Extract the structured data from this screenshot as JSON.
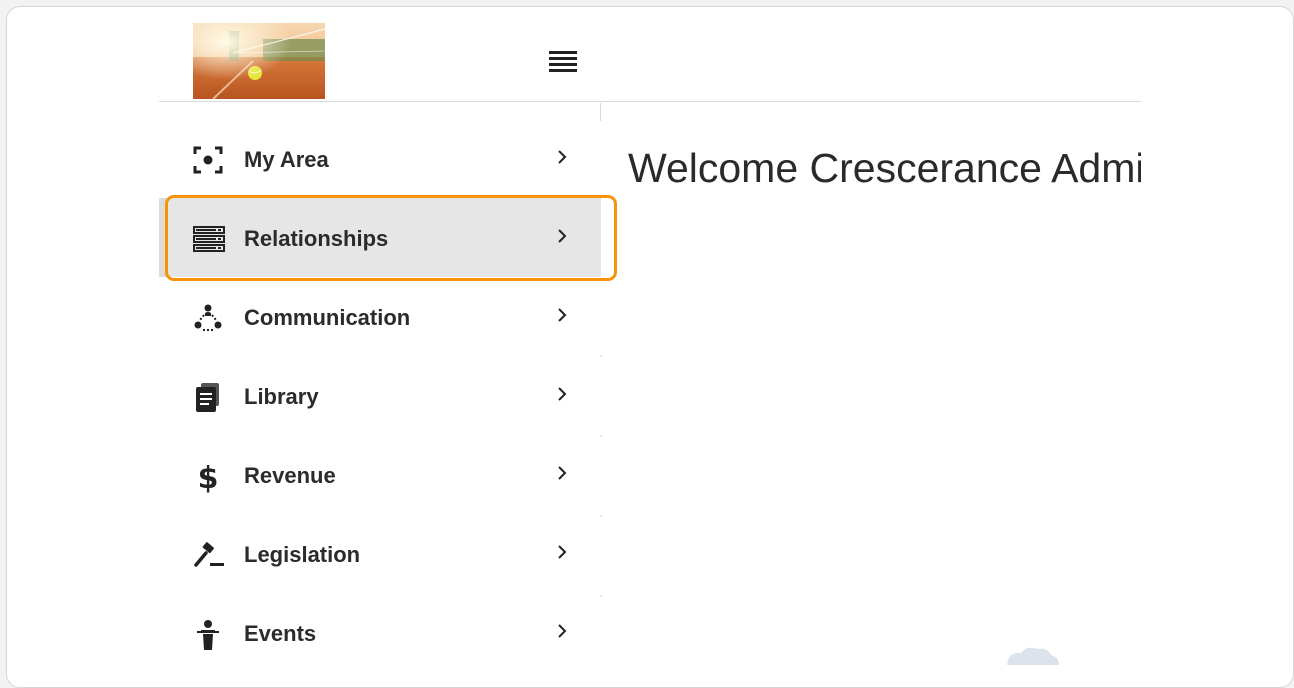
{
  "header": {
    "logo_alt": "tennis-court-logo",
    "menu_icon": "hamburger-menu-icon"
  },
  "sidebar": {
    "items": [
      {
        "label": "My Area",
        "icon": "focus-target-icon",
        "active": false
      },
      {
        "label": "Relationships",
        "icon": "server-stack-icon",
        "active": true
      },
      {
        "label": "Communication",
        "icon": "people-network-icon",
        "active": false
      },
      {
        "label": "Library",
        "icon": "documents-icon",
        "active": false
      },
      {
        "label": "Revenue",
        "icon": "dollar-icon",
        "active": false
      },
      {
        "label": "Legislation",
        "icon": "gavel-icon",
        "active": false
      },
      {
        "label": "Events",
        "icon": "speaker-podium-icon",
        "active": false
      }
    ]
  },
  "main": {
    "welcome": "Welcome Crescerance Admi"
  },
  "colors": {
    "highlight": "#f5930b",
    "active_bg": "#e6e6e6",
    "text": "#2b2b2b"
  }
}
